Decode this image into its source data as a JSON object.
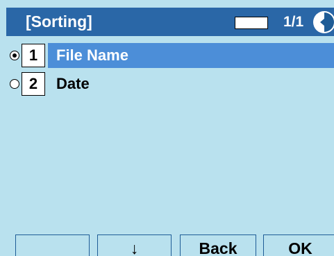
{
  "header": {
    "title": "[Sorting]",
    "input_value": "",
    "page_indicator": "1/1",
    "back_icon": "back-arrow-icon"
  },
  "list": {
    "items": [
      {
        "number": "1",
        "label": "File Name",
        "selected": true,
        "highlighted": true
      },
      {
        "number": "2",
        "label": "Date",
        "selected": false,
        "highlighted": false
      }
    ]
  },
  "softkeys": {
    "key1": "",
    "key2": "↓",
    "key3": "Back",
    "key4": "OK"
  },
  "colors": {
    "background": "#b9e1ee",
    "title_bar": "#2a67a7",
    "highlight": "#4c8ed8",
    "softkey_border": "#1e5c96"
  }
}
